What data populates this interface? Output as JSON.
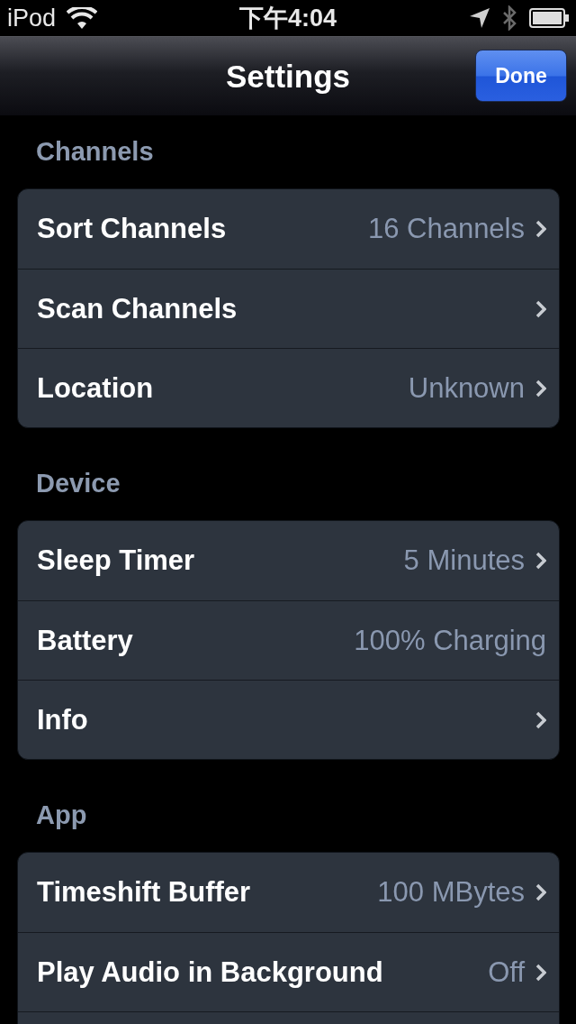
{
  "status_bar": {
    "carrier": "iPod",
    "time": "下午4:04"
  },
  "nav_bar": {
    "title": "Settings",
    "done_button": "Done"
  },
  "sections": [
    {
      "header": "Channels",
      "rows": [
        {
          "label": "Sort Channels",
          "value": "16 Channels",
          "chevron": true
        },
        {
          "label": "Scan Channels",
          "chevron": true
        },
        {
          "label": "Location",
          "value": "Unknown",
          "chevron": true
        }
      ]
    },
    {
      "header": "Device",
      "rows": [
        {
          "label": "Sleep Timer",
          "value": "5 Minutes",
          "chevron": true
        },
        {
          "label": "Battery",
          "value": "100% Charging",
          "chevron": false
        },
        {
          "label": "Info",
          "chevron": true
        }
      ]
    },
    {
      "header": "App",
      "rows": [
        {
          "label": "Timeshift Buffer",
          "value": "100 MBytes",
          "chevron": true
        },
        {
          "label": "Play Audio in Background",
          "value": "Off",
          "chevron": true
        }
      ]
    }
  ]
}
